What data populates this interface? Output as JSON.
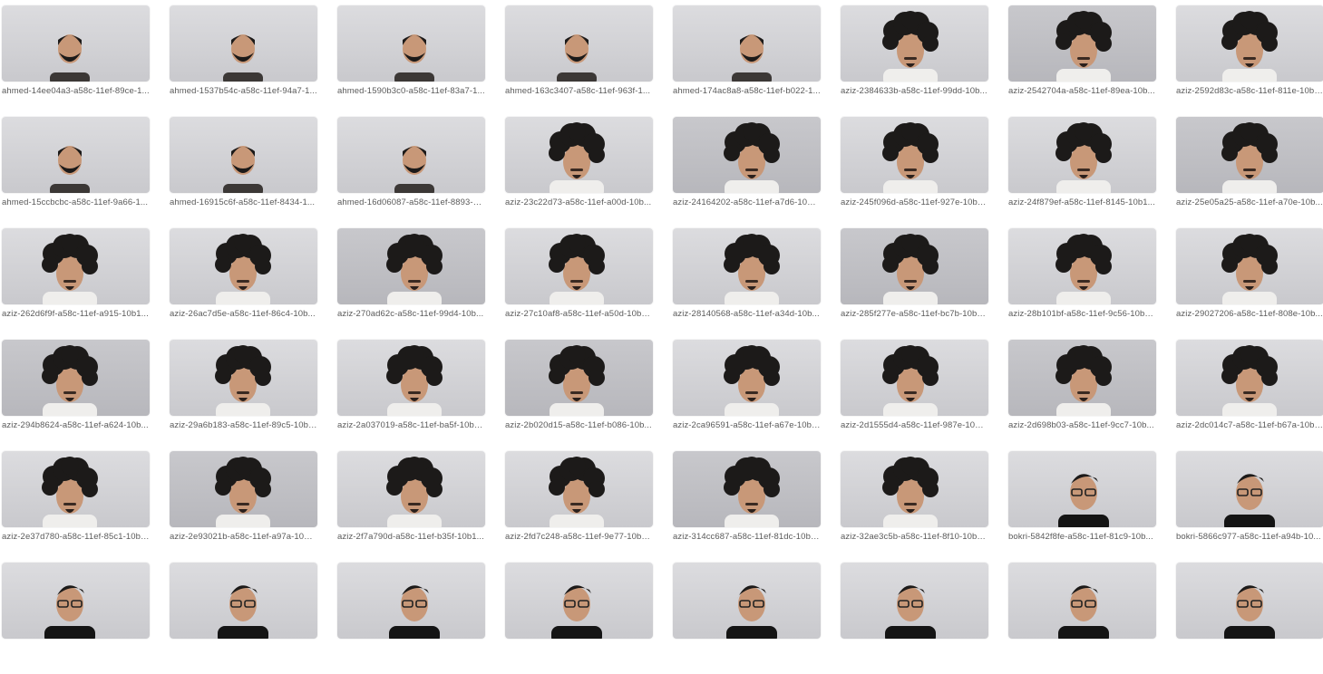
{
  "files": [
    {
      "name": "ahmed-14ee04a3-a58c-11ef-89ce-1...",
      "subject": "short-hair"
    },
    {
      "name": "ahmed-1537b54c-a58c-11ef-94a7-1...",
      "subject": "short-hair"
    },
    {
      "name": "ahmed-1590b3c0-a58c-11ef-83a7-1...",
      "subject": "short-hair"
    },
    {
      "name": "ahmed-163c3407-a58c-11ef-963f-1...",
      "subject": "short-hair"
    },
    {
      "name": "ahmed-174ac8a8-a58c-11ef-b022-1...",
      "subject": "short-hair"
    },
    {
      "name": "aziz-2384633b-a58c-11ef-99dd-10b...",
      "subject": "curly-hair"
    },
    {
      "name": "aziz-2542704a-a58c-11ef-89ea-10b...",
      "subject": "curly-hair"
    },
    {
      "name": "aziz-2592d83c-a58c-11ef-811e-10b1...",
      "subject": "curly-hair"
    },
    {
      "name": "ahmed-15ccbcbc-a58c-11ef-9a66-1...",
      "subject": "short-hair"
    },
    {
      "name": "ahmed-16915c6f-a58c-11ef-8434-1...",
      "subject": "short-hair"
    },
    {
      "name": "ahmed-16d06087-a58c-11ef-8893-1...",
      "subject": "short-hair"
    },
    {
      "name": "aziz-23c22d73-a58c-11ef-a00d-10b...",
      "subject": "curly-hair"
    },
    {
      "name": "aziz-24164202-a58c-11ef-a7d6-10b1...",
      "subject": "curly-hair"
    },
    {
      "name": "aziz-245f096d-a58c-11ef-927e-10b1...",
      "subject": "curly-hair"
    },
    {
      "name": "aziz-24f879ef-a58c-11ef-8145-10b1...",
      "subject": "curly-hair"
    },
    {
      "name": "aziz-25e05a25-a58c-11ef-a70e-10b...",
      "subject": "curly-hair"
    },
    {
      "name": "aziz-262d6f9f-a58c-11ef-a915-10b1...",
      "subject": "curly-hair"
    },
    {
      "name": "aziz-26ac7d5e-a58c-11ef-86c4-10b...",
      "subject": "curly-hair"
    },
    {
      "name": "aziz-270ad62c-a58c-11ef-99d4-10b...",
      "subject": "curly-hair"
    },
    {
      "name": "aziz-27c10af8-a58c-11ef-a50d-10b1...",
      "subject": "curly-hair"
    },
    {
      "name": "aziz-28140568-a58c-11ef-a34d-10b...",
      "subject": "curly-hair"
    },
    {
      "name": "aziz-285f277e-a58c-11ef-bc7b-10b1...",
      "subject": "curly-hair"
    },
    {
      "name": "aziz-28b101bf-a58c-11ef-9c56-10b1...",
      "subject": "curly-hair"
    },
    {
      "name": "aziz-29027206-a58c-11ef-808e-10b...",
      "subject": "curly-hair"
    },
    {
      "name": "aziz-294b8624-a58c-11ef-a624-10b...",
      "subject": "curly-hair"
    },
    {
      "name": "aziz-29a6b183-a58c-11ef-89c5-10b1...",
      "subject": "curly-hair"
    },
    {
      "name": "aziz-2a037019-a58c-11ef-ba5f-10b1...",
      "subject": "curly-hair"
    },
    {
      "name": "aziz-2b020d15-a58c-11ef-b086-10b...",
      "subject": "curly-hair"
    },
    {
      "name": "aziz-2ca96591-a58c-11ef-a67e-10b1...",
      "subject": "curly-hair"
    },
    {
      "name": "aziz-2d1555d4-a58c-11ef-987e-10b1...",
      "subject": "curly-hair"
    },
    {
      "name": "aziz-2d698b03-a58c-11ef-9cc7-10b...",
      "subject": "curly-hair"
    },
    {
      "name": "aziz-2dc014c7-a58c-11ef-b67a-10b1...",
      "subject": "curly-hair"
    },
    {
      "name": "aziz-2e37d780-a58c-11ef-85c1-10b1...",
      "subject": "curly-hair"
    },
    {
      "name": "aziz-2e93021b-a58c-11ef-a97a-10b1...",
      "subject": "curly-hair"
    },
    {
      "name": "aziz-2f7a790d-a58c-11ef-b35f-10b1...",
      "subject": "curly-hair"
    },
    {
      "name": "aziz-2fd7c248-a58c-11ef-9e77-10b1...",
      "subject": "curly-hair"
    },
    {
      "name": "aziz-314cc687-a58c-11ef-81dc-10b1...",
      "subject": "curly-hair"
    },
    {
      "name": "aziz-32ae3c5b-a58c-11ef-8f10-10b1...",
      "subject": "curly-hair"
    },
    {
      "name": "bokri-5842f8fe-a58c-11ef-81c9-10b...",
      "subject": "glasses"
    },
    {
      "name": "bokri-5866c977-a58c-11ef-a94b-10...",
      "subject": "glasses"
    },
    {
      "name": "",
      "subject": "glasses"
    },
    {
      "name": "",
      "subject": "glasses"
    },
    {
      "name": "",
      "subject": "glasses"
    },
    {
      "name": "",
      "subject": "glasses"
    },
    {
      "name": "",
      "subject": "glasses"
    },
    {
      "name": "",
      "subject": "glasses"
    },
    {
      "name": "",
      "subject": "glasses"
    },
    {
      "name": "",
      "subject": "glasses"
    }
  ],
  "colors": {
    "background": "#ffffff",
    "caption": "#5a5a5a",
    "thumb_bg": "#d2d2d6",
    "hair": "#1c1a19",
    "skin": "#c89878"
  }
}
